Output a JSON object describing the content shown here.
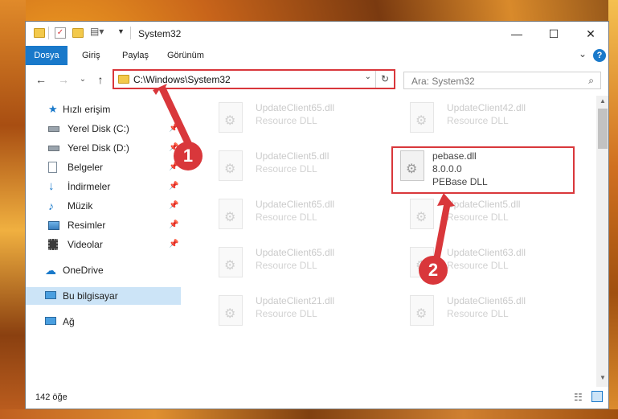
{
  "window": {
    "title": "System32"
  },
  "titlebar": {
    "minimize": "—",
    "maximize": "☐",
    "close": "✕"
  },
  "ribbon": {
    "tabs": [
      "Dosya",
      "Giriş",
      "Paylaş",
      "Görünüm"
    ],
    "collapse": "⌄",
    "help": "?"
  },
  "nav": {
    "back": "←",
    "forward": "→",
    "recent": "⌄",
    "up": "↑",
    "address": "C:\\Windows\\System32",
    "address_drop": "⌄",
    "refresh": "↻"
  },
  "search": {
    "placeholder": "Ara: System32",
    "icon": "⌕"
  },
  "sidebar": {
    "items": [
      {
        "label": "Hızlı erişim",
        "icon": "star-icon",
        "pinned": false
      },
      {
        "label": "Yerel Disk (C:)",
        "icon": "drive-icon",
        "pinned": true
      },
      {
        "label": "Yerel Disk (D:)",
        "icon": "drive-icon",
        "pinned": true
      },
      {
        "label": "Belgeler",
        "icon": "documents-icon",
        "pinned": true
      },
      {
        "label": "İndirmeler",
        "icon": "download-icon",
        "pinned": true
      },
      {
        "label": "Müzik",
        "icon": "music-icon",
        "pinned": true
      },
      {
        "label": "Resimler",
        "icon": "pictures-icon",
        "pinned": true
      },
      {
        "label": "Videolar",
        "icon": "videos-icon",
        "pinned": true
      },
      {
        "label": "OneDrive",
        "icon": "cloud-icon",
        "pinned": false
      },
      {
        "label": "Bu bilgisayar",
        "icon": "computer-icon",
        "pinned": false
      },
      {
        "label": "Ağ",
        "icon": "network-icon",
        "pinned": false
      }
    ],
    "pin_glyph": "📌"
  },
  "files": [
    {
      "name": "UpdateClient65.dll",
      "desc": "Resource DLL"
    },
    {
      "name": "UpdateClient42.dll",
      "desc": "Resource DLL"
    },
    {
      "name": "UpdateClient5.dll",
      "desc": "Resource DLL"
    },
    {
      "name": "pebase.dll",
      "version": "8.0.0.0",
      "desc": "PEBase DLL"
    },
    {
      "name": "UpdateClient65.dll",
      "desc": "Resource DLL"
    },
    {
      "name": "UpdateClient5.dll",
      "desc": "Resource DLL"
    },
    {
      "name": "UpdateClient65.dll",
      "desc": "Resource DLL"
    },
    {
      "name": "UpdateClient63.dll",
      "desc": "Resource DLL"
    },
    {
      "name": "UpdateClient21.dll",
      "desc": "Resource DLL"
    },
    {
      "name": "UpdateClient65.dll",
      "desc": "Resource DLL"
    }
  ],
  "annotations": {
    "badge1": "1",
    "badge2": "2"
  },
  "status": {
    "count": "142 öğe"
  },
  "colors": {
    "accent": "#1979ca",
    "highlight": "#d9373b",
    "selected": "#cce4f7"
  }
}
